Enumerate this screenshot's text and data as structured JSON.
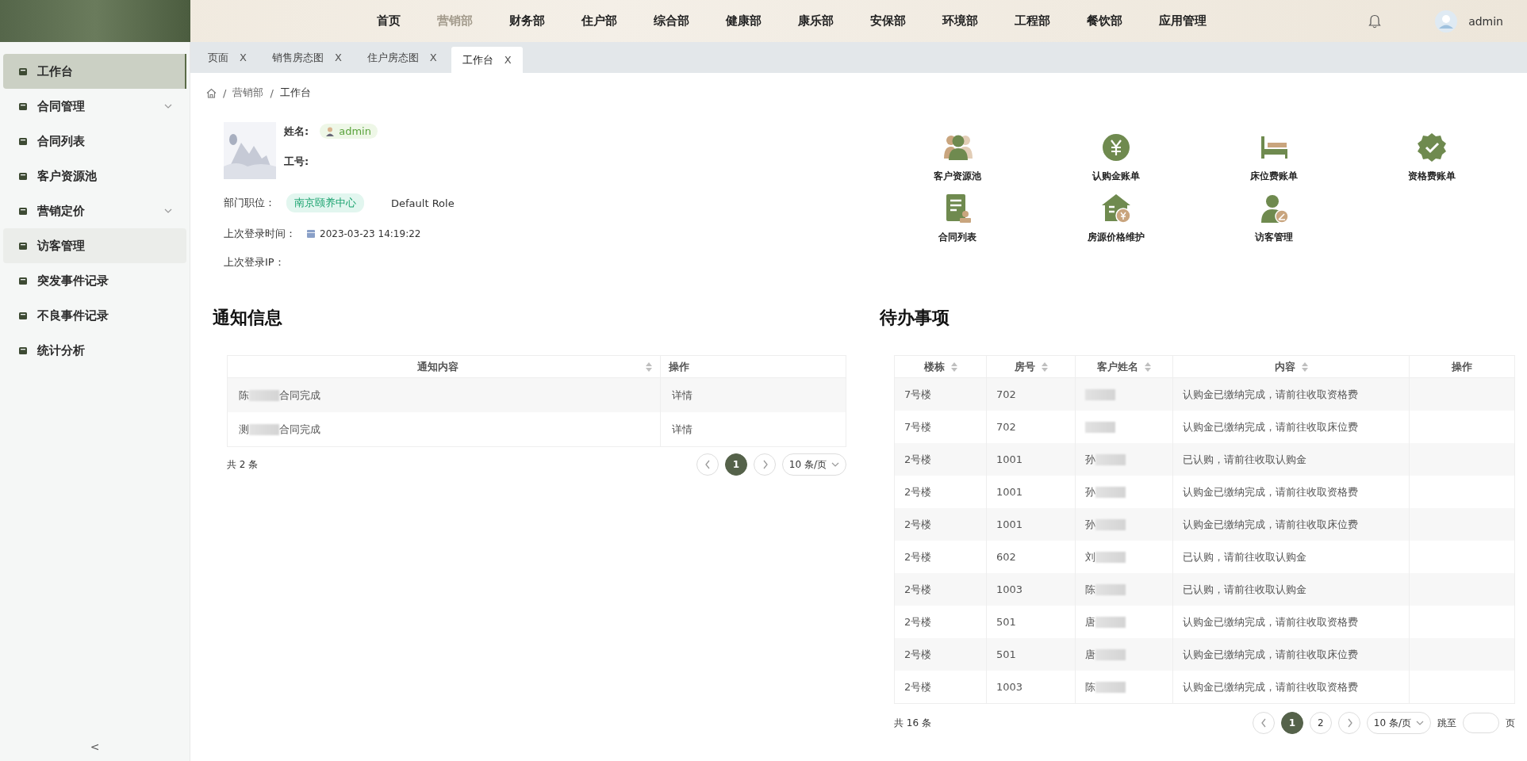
{
  "header": {
    "nav": [
      {
        "label": "首页",
        "selected": false
      },
      {
        "label": "营销部",
        "selected": true
      },
      {
        "label": "财务部",
        "selected": false
      },
      {
        "label": "住户部",
        "selected": false
      },
      {
        "label": "综合部",
        "selected": false
      },
      {
        "label": "健康部",
        "selected": false
      },
      {
        "label": "康乐部",
        "selected": false
      },
      {
        "label": "安保部",
        "selected": false
      },
      {
        "label": "环境部",
        "selected": false
      },
      {
        "label": "工程部",
        "selected": false
      },
      {
        "label": "餐饮部",
        "selected": false
      },
      {
        "label": "应用管理",
        "selected": false
      }
    ],
    "user": "admin"
  },
  "tabs": [
    {
      "label": "页面",
      "close": "X",
      "selected": false
    },
    {
      "label": "销售房态图",
      "close": "X",
      "selected": false
    },
    {
      "label": "住户房态图",
      "close": "X",
      "selected": false
    },
    {
      "label": "工作台",
      "close": "X",
      "selected": true
    }
  ],
  "sidebar": {
    "items": [
      {
        "label": "工作台",
        "kind": "item",
        "selected": true,
        "hovered": false
      },
      {
        "label": "合同管理",
        "kind": "submenu",
        "selected": false,
        "hovered": false
      },
      {
        "label": "合同列表",
        "kind": "item",
        "selected": false,
        "hovered": false
      },
      {
        "label": "客户资源池",
        "kind": "item",
        "selected": false,
        "hovered": false
      },
      {
        "label": "营销定价",
        "kind": "submenu",
        "selected": false,
        "hovered": false
      },
      {
        "label": "访客管理",
        "kind": "item",
        "selected": false,
        "hovered": true
      },
      {
        "label": "突发事件记录",
        "kind": "item",
        "selected": false,
        "hovered": false
      },
      {
        "label": "不良事件记录",
        "kind": "item",
        "selected": false,
        "hovered": false
      },
      {
        "label": "统计分析",
        "kind": "item",
        "selected": false,
        "hovered": false
      }
    ],
    "collapse": "<"
  },
  "breadcrumb": {
    "separator": "/",
    "items": [
      "营销部",
      "工作台"
    ]
  },
  "profile": {
    "name_label": "姓名:",
    "name": "admin",
    "id_label": "工号:",
    "dept_label": "部门职位：",
    "dept": "南京颐养中心",
    "role": "Default Role",
    "login_time_label": "上次登录时间：",
    "login_time": "2023-03-23 14:19:22",
    "login_ip_label": "上次登录IP："
  },
  "quick_links": [
    {
      "label": "客户资源池",
      "kind": "people"
    },
    {
      "label": "认购金账单",
      "kind": "yen"
    },
    {
      "label": "床位费账单",
      "kind": "bed"
    },
    {
      "label": "资格费账单",
      "kind": "badge"
    },
    {
      "label": "合同列表",
      "kind": "document"
    },
    {
      "label": "房源价格维护",
      "kind": "house"
    },
    {
      "label": "访客管理",
      "kind": "visitor"
    }
  ],
  "notices": {
    "title": "通知信息",
    "columns": [
      {
        "label": "通知内容",
        "sortable": true
      },
      {
        "label": "操作",
        "sortable": false
      }
    ],
    "rows": [
      {
        "content_start": "陈",
        "content_end": "合同完成",
        "action": "详情"
      },
      {
        "content_start": "测",
        "content_end": "合同完成",
        "action": "详情"
      }
    ],
    "total": "共 2 条",
    "pages": [
      {
        "label": "1",
        "selected": true
      }
    ],
    "page_size": "10 条/页"
  },
  "todos": {
    "title": "待办事项",
    "columns": [
      {
        "label": "楼栋",
        "sortable": true
      },
      {
        "label": "房号",
        "sortable": true
      },
      {
        "label": "客户姓名",
        "sortable": true
      },
      {
        "label": "内容",
        "sortable": true
      },
      {
        "label": "操作",
        "sortable": false
      }
    ],
    "rows": [
      {
        "building": "7号楼",
        "room": "702",
        "content": "认购金已缴纳完成，请前往收取资格费"
      },
      {
        "building": "7号楼",
        "room": "702",
        "content": "认购金已缴纳完成，请前往收取床位费"
      },
      {
        "building": "2号楼",
        "room": "1001",
        "name": "孙",
        "content": "已认购，请前往收取认购金"
      },
      {
        "building": "2号楼",
        "room": "1001",
        "name": "孙",
        "content": "认购金已缴纳完成，请前往收取资格费"
      },
      {
        "building": "2号楼",
        "room": "1001",
        "name": "孙",
        "content": "认购金已缴纳完成，请前往收取床位费"
      },
      {
        "building": "2号楼",
        "room": "602",
        "name": "刘",
        "content": "已认购，请前往收取认购金"
      },
      {
        "building": "2号楼",
        "room": "1003",
        "name": "陈",
        "content": "已认购，请前往收取认购金"
      },
      {
        "building": "2号楼",
        "room": "501",
        "name": "唐",
        "content": "认购金已缴纳完成，请前往收取资格费"
      },
      {
        "building": "2号楼",
        "room": "501",
        "name": "唐",
        "content": "认购金已缴纳完成，请前往收取床位费"
      },
      {
        "building": "2号楼",
        "room": "1003",
        "name": "陈",
        "content": "认购金已缴纳完成，请前往收取资格费"
      }
    ],
    "total": "共 16 条",
    "pages": [
      {
        "label": "1",
        "selected": true
      },
      {
        "label": "2",
        "selected": false
      }
    ],
    "page_size": "10 条/页",
    "jump_label": "跳至",
    "jump_suffix": "页"
  }
}
